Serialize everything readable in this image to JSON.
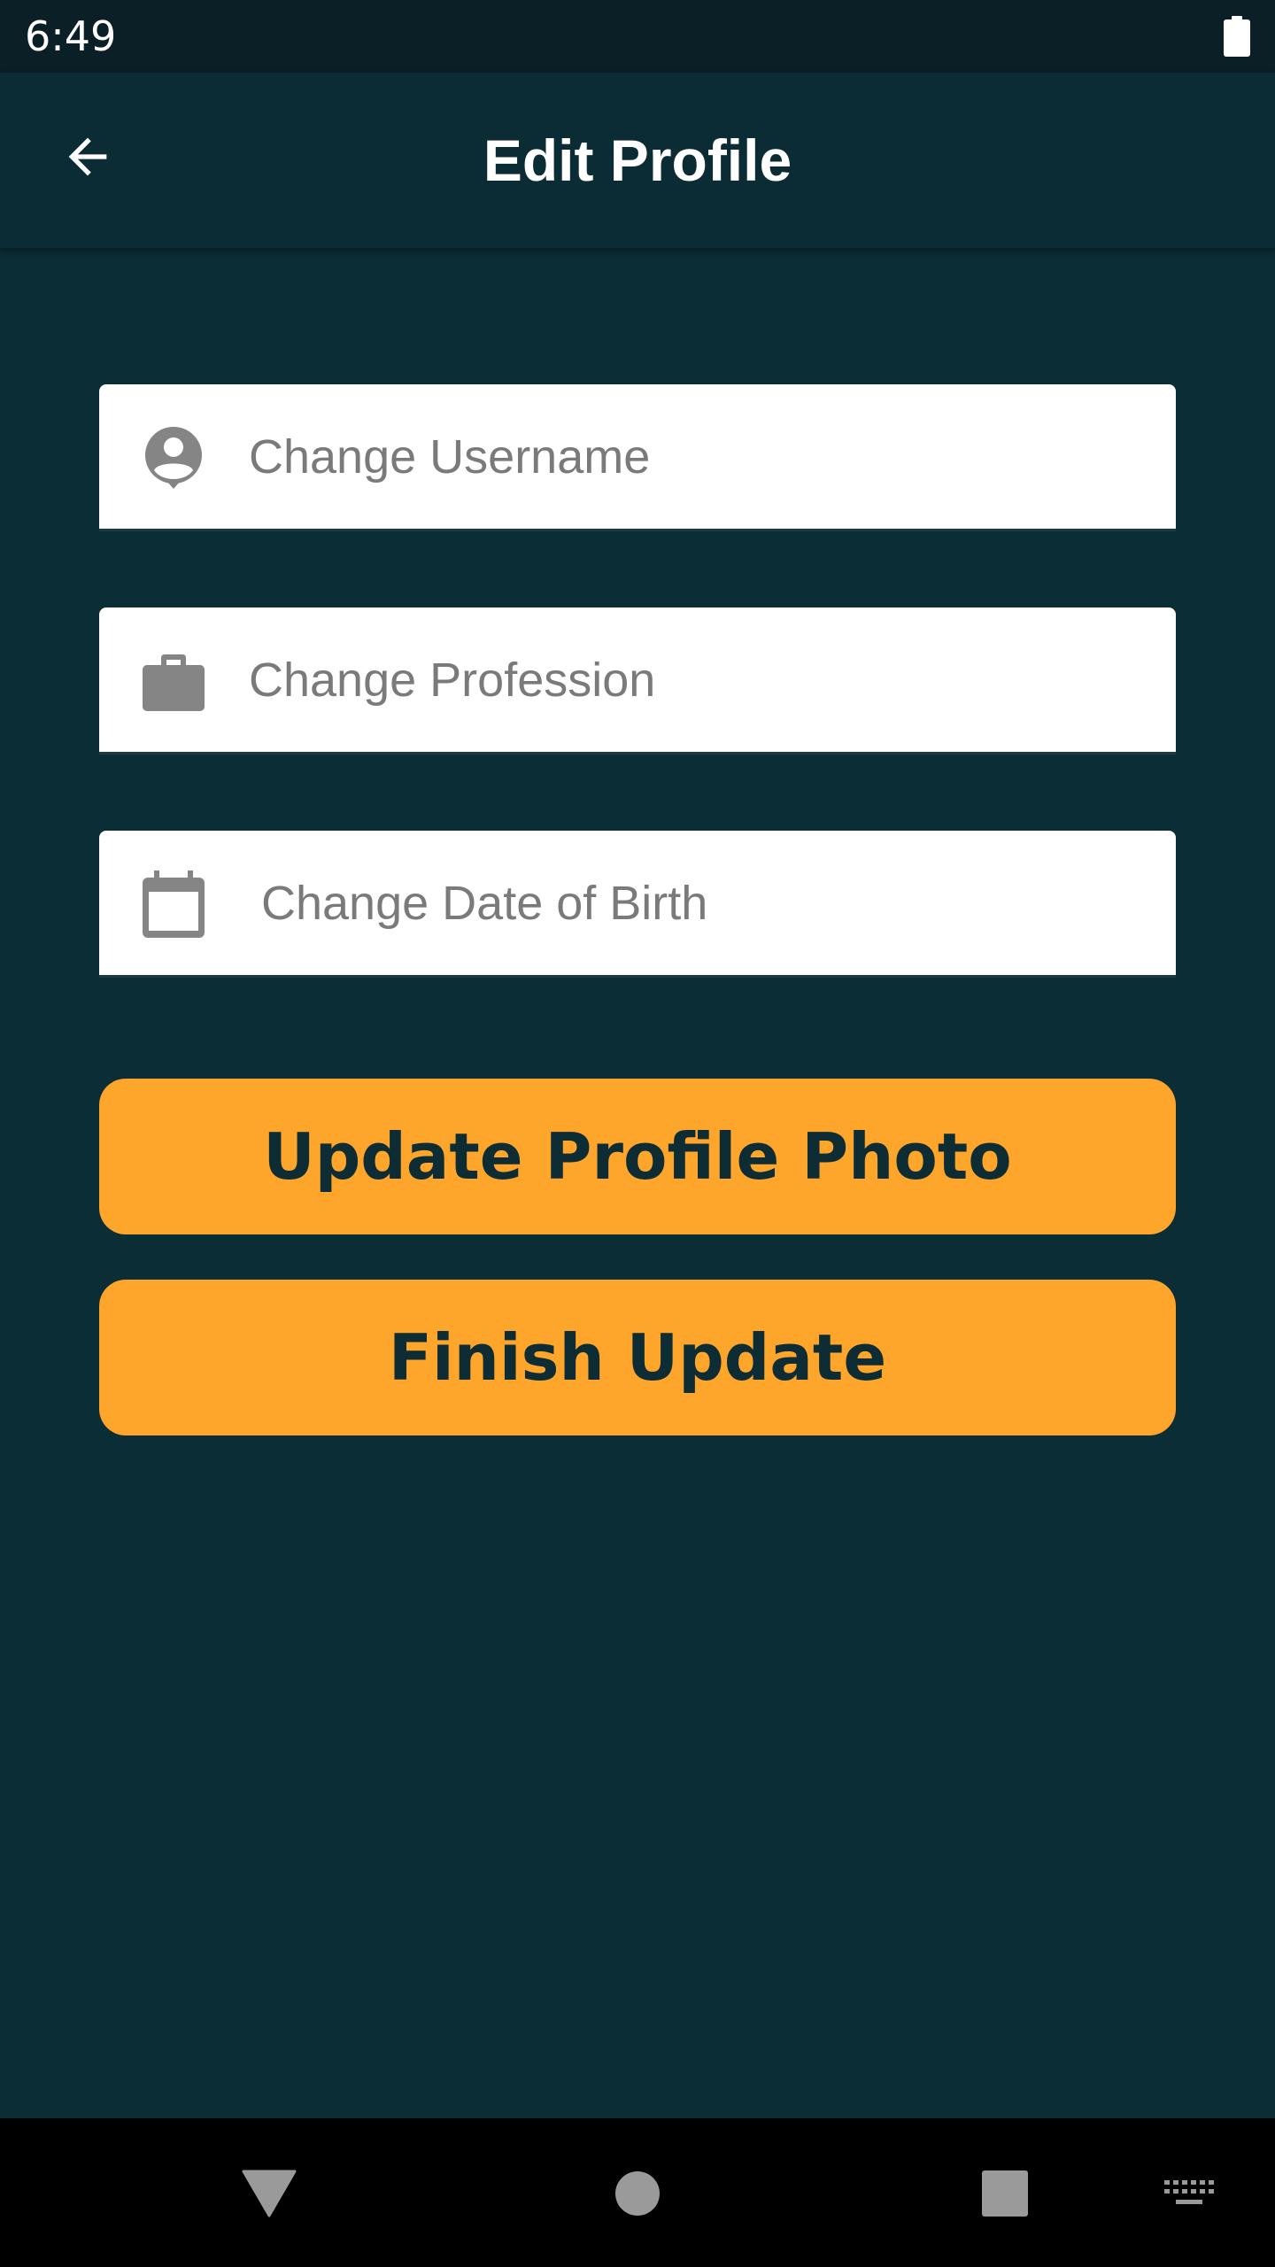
{
  "status_bar": {
    "time": "6:49"
  },
  "app_bar": {
    "title": "Edit Profile"
  },
  "form": {
    "username": {
      "placeholder": "Change Username",
      "value": ""
    },
    "profession": {
      "placeholder": "Change Profession",
      "value": ""
    },
    "date_of_birth": {
      "placeholder": "Change Date of Birth",
      "value": ""
    }
  },
  "buttons": {
    "update_photo_label": "Update Profile Photo",
    "finish_label": "Finish Update"
  },
  "icons": {
    "back": "arrow-back-icon",
    "username": "account-circle-icon",
    "profession": "briefcase-icon",
    "date_of_birth": "calendar-icon",
    "battery": "battery-icon",
    "nav_back": "triangle-back-icon",
    "nav_home": "circle-home-icon",
    "nav_recents": "square-recents-icon",
    "keyboard": "keyboard-icon"
  },
  "colors": {
    "background": "#0b2d35",
    "status_bar": "#0a1f26",
    "accent": "#fea52b",
    "button_text": "#0d2c33",
    "field_background": "#ffffff",
    "placeholder": "#7a7a7a",
    "icon_grey": "#858585"
  }
}
